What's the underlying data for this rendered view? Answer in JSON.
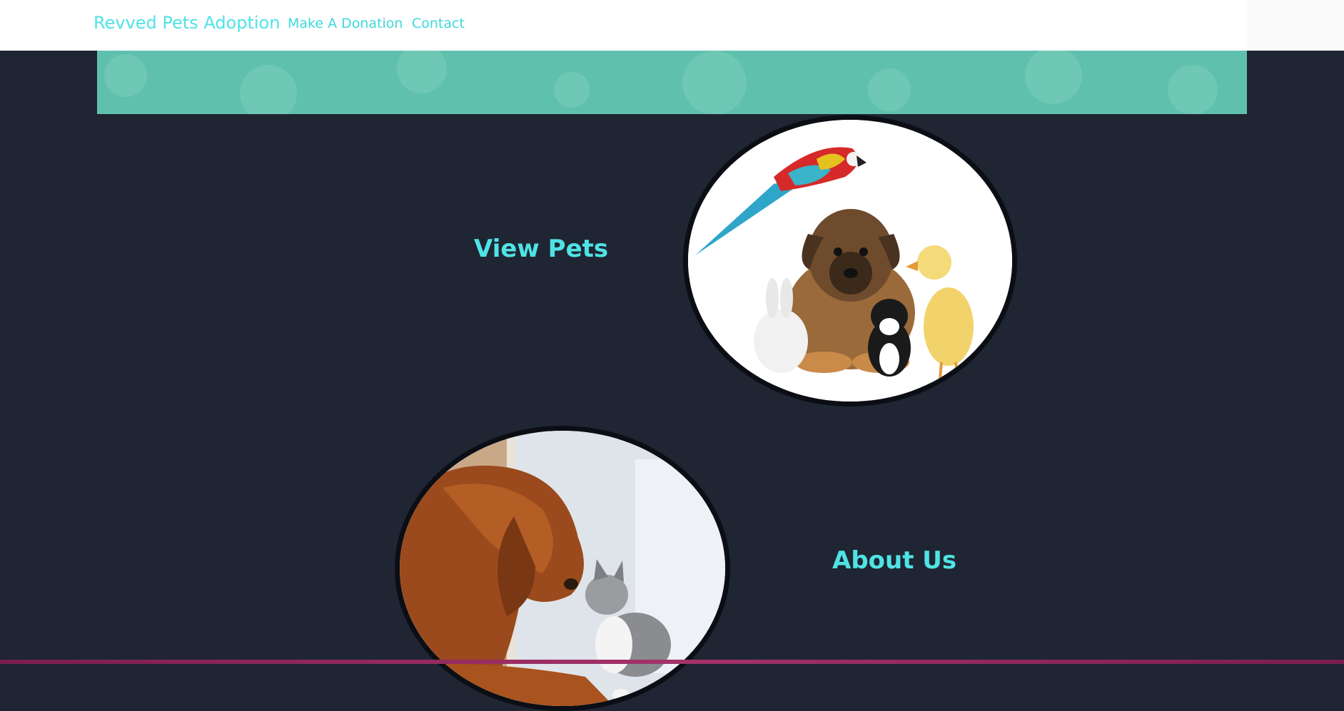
{
  "navbar": {
    "brand": "Revved Pets Adoption",
    "links": [
      "Make A Donation",
      "Contact"
    ]
  },
  "sections": {
    "view_pets": {
      "title": "View Pets"
    },
    "about_us": {
      "title": "About Us"
    }
  },
  "colors": {
    "background": "#1f2532",
    "accent": "#4fe3e6",
    "banner": "#5fc1ad"
  }
}
